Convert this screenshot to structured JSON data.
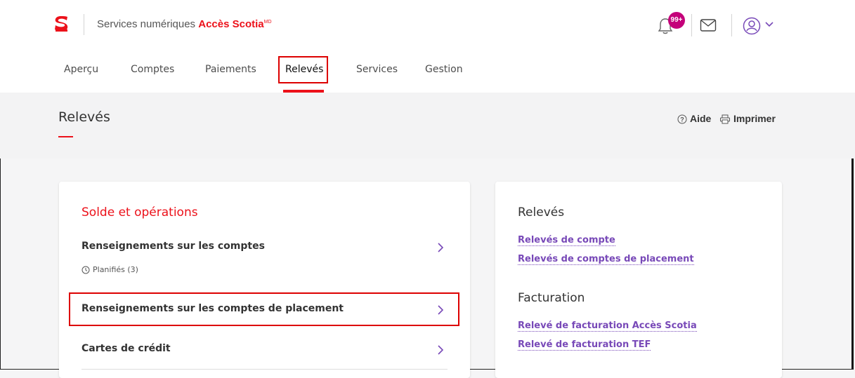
{
  "header": {
    "brand_prefix": "Services numériques ",
    "brand_name": "Accès Scotia",
    "brand_mark": "MD",
    "notifications_badge": "99+",
    "accent_color": "#ec111a",
    "badge_color": "#c4007a",
    "icons": [
      "scotiabank-logo-icon",
      "bell-icon",
      "mail-icon",
      "user-icon",
      "chevron-down-icon"
    ]
  },
  "nav": {
    "tabs": [
      {
        "label": "Aperçu"
      },
      {
        "label": "Comptes"
      },
      {
        "label": "Paiements"
      },
      {
        "label": "Relevés",
        "active": true
      },
      {
        "label": "Services"
      },
      {
        "label": "Gestion"
      }
    ]
  },
  "page": {
    "title": "Relevés",
    "help_label": "Aide",
    "print_label": "Imprimer"
  },
  "left_card": {
    "section_title": "Solde et opérations",
    "rows": [
      {
        "label": "Renseignements sur les comptes",
        "sub": "Planifiés (3)"
      },
      {
        "label": "Renseignements sur les comptes de placement",
        "highlighted": true
      },
      {
        "label": "Cartes de crédit"
      }
    ]
  },
  "right_card": {
    "sections": [
      {
        "heading": "Relevés",
        "links": [
          "Relevés de compte",
          "Relevés de comptes de placement"
        ]
      },
      {
        "heading": "Facturation",
        "links": [
          "Relevé de facturation Accès Scotia",
          "Relevé de facturation TEF"
        ]
      }
    ],
    "link_color": "#7849b8"
  }
}
